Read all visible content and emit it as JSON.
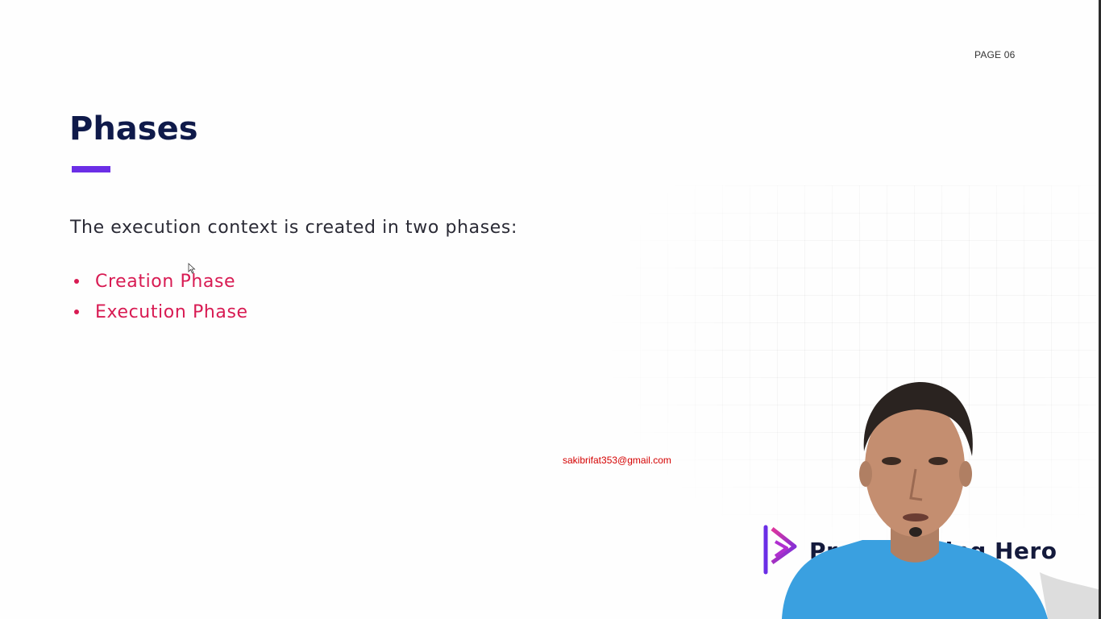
{
  "page_label": "PAGE 06",
  "title": "Phases",
  "intro": "The execution context is created in two phases:",
  "phases": [
    {
      "label": "Creation Phase"
    },
    {
      "label": "Execution Phase"
    }
  ],
  "watermark_email": "sakibrifat353@gmail.com",
  "brand": {
    "name": "Programming Hero",
    "icon": "play-logo-icon"
  },
  "colors": {
    "title": "#0f1a4a",
    "accent_bar": "#6b2ee6",
    "list_text": "#d81b53",
    "watermark": "#d40000",
    "shirt": "#3aa0e0"
  }
}
